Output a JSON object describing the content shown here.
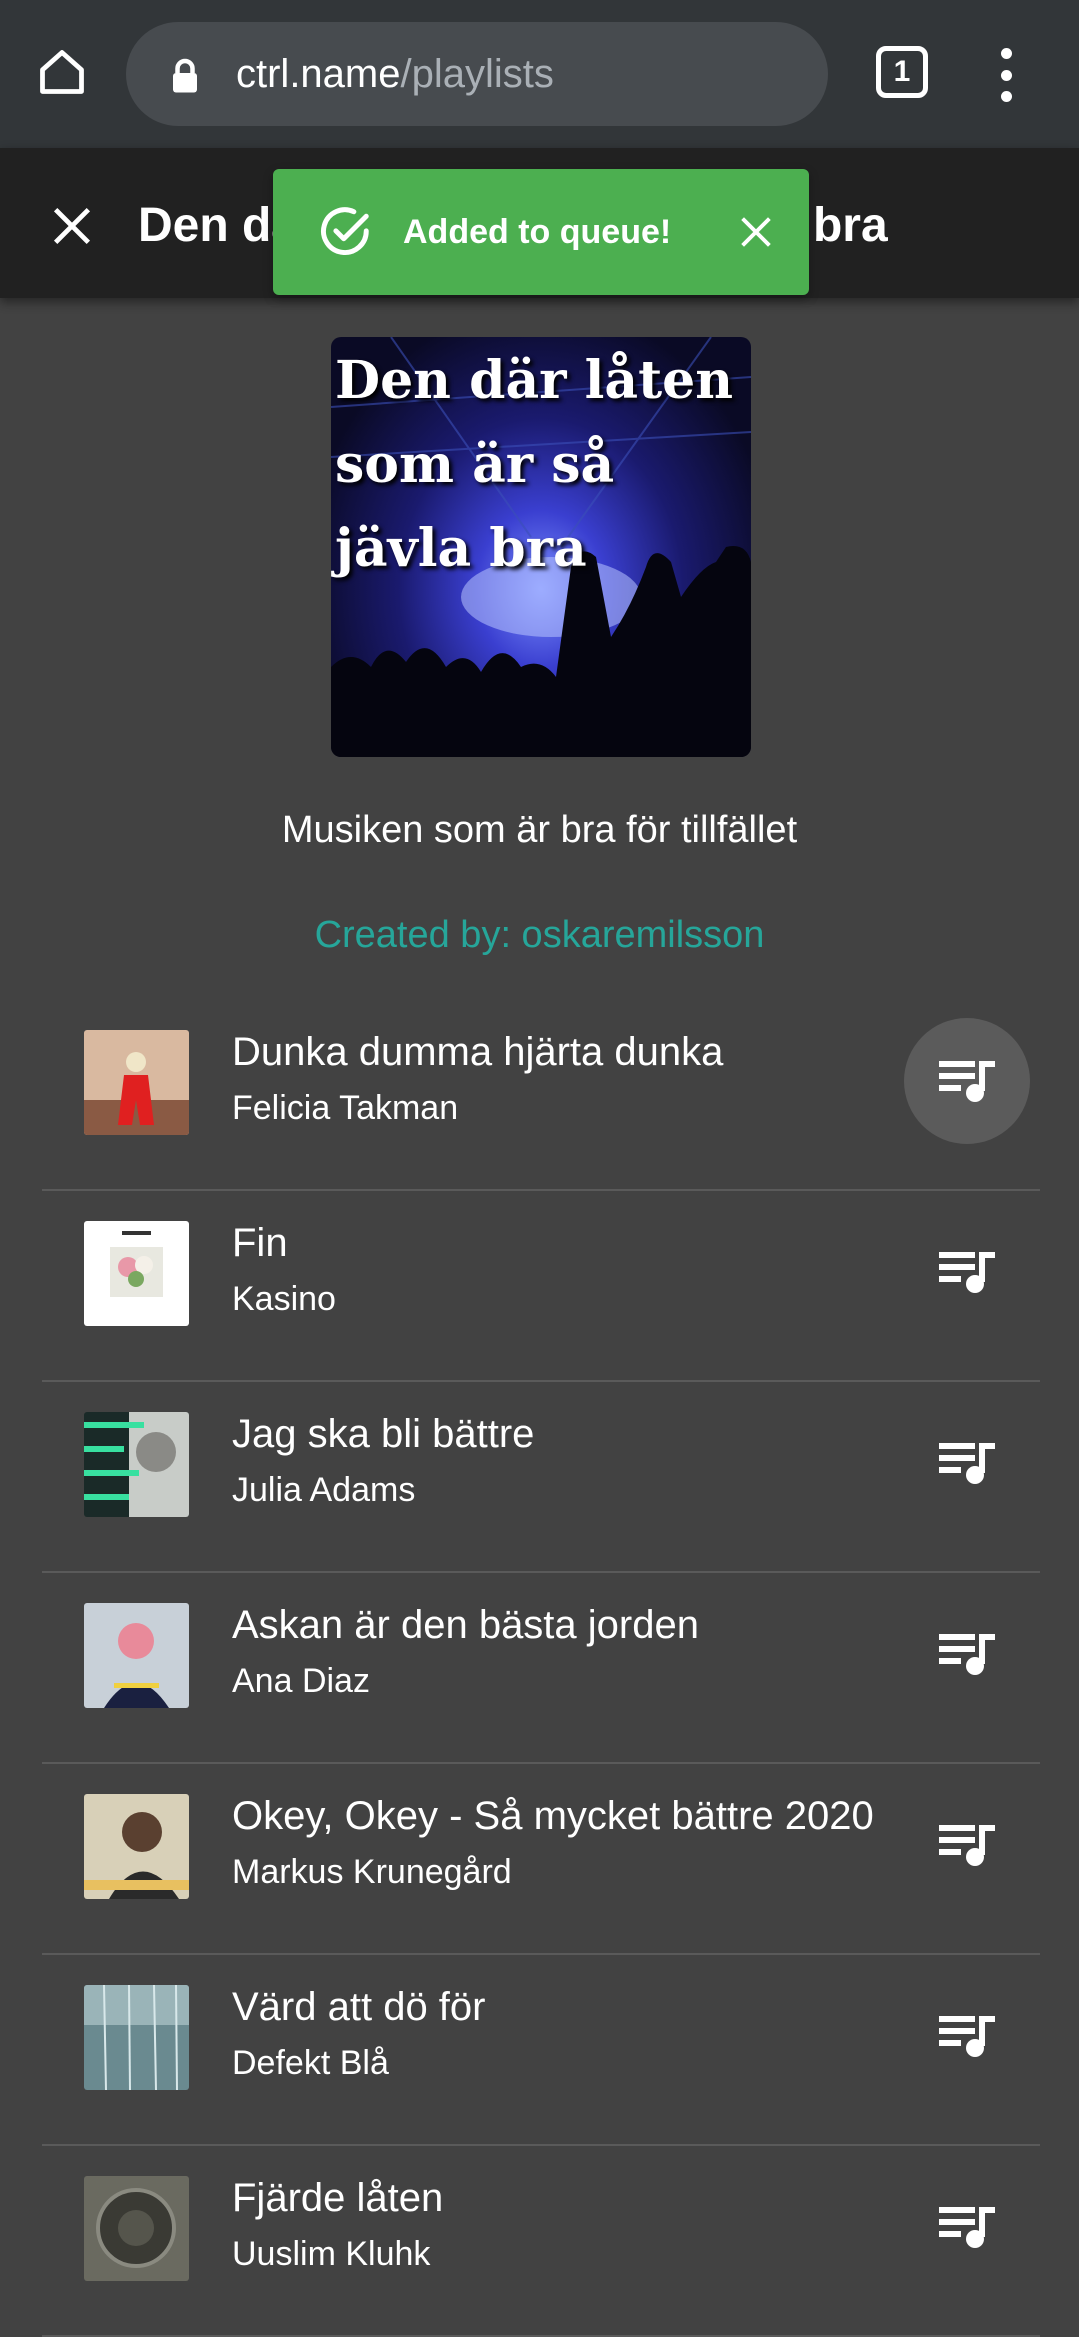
{
  "browser": {
    "url_host": "ctrl.name",
    "url_path": "/playlists",
    "tab_count": "1"
  },
  "app_bar": {
    "title": "Den där låten som är så jävla bra"
  },
  "toast": {
    "message": "Added to queue!",
    "color": "#4caf50"
  },
  "playlist": {
    "cover_text": "Den där låten som är så jävla bra",
    "description": "Musiken som är bra för tillfället",
    "created_by": "Created by: oskaremilsson"
  },
  "tracks": [
    {
      "title": "Dunka dumma hjärta dunka",
      "artist": "Felicia Takman"
    },
    {
      "title": "Fin",
      "artist": "Kasino"
    },
    {
      "title": "Jag ska bli bättre",
      "artist": "Julia Adams"
    },
    {
      "title": "Askan är den bästa jorden",
      "artist": "Ana Diaz"
    },
    {
      "title": "Okey, Okey - Så mycket bättre 2020",
      "artist": "Markus Krunegård"
    },
    {
      "title": "Värd att dö för",
      "artist": "Defekt Blå"
    },
    {
      "title": "Fjärde låten",
      "artist": "Uuslim Kluhk"
    }
  ],
  "colors": {
    "background": "#424242",
    "app_bar": "#212121",
    "browser_bar": "#323639",
    "accent_teal": "#26a69a"
  }
}
